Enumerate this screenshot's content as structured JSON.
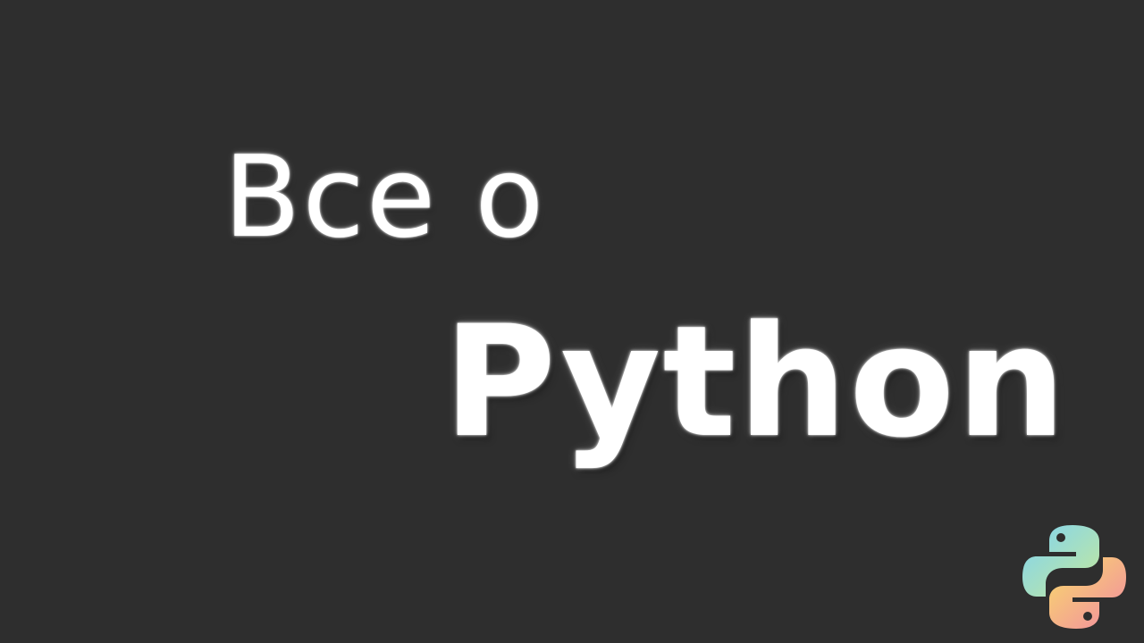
{
  "headline": {
    "line1": "Все о",
    "line2": "Python"
  },
  "logo": {
    "icon": "python-logo-icon",
    "colors": {
      "top": "#8ad6ee",
      "top_end": "#b9e6a0",
      "bottom": "#f6d46a",
      "bottom_end": "#f38fa0",
      "eye": "#2e2e2e"
    }
  },
  "colors": {
    "background": "#2e2e2e",
    "text": "#ffffff"
  }
}
